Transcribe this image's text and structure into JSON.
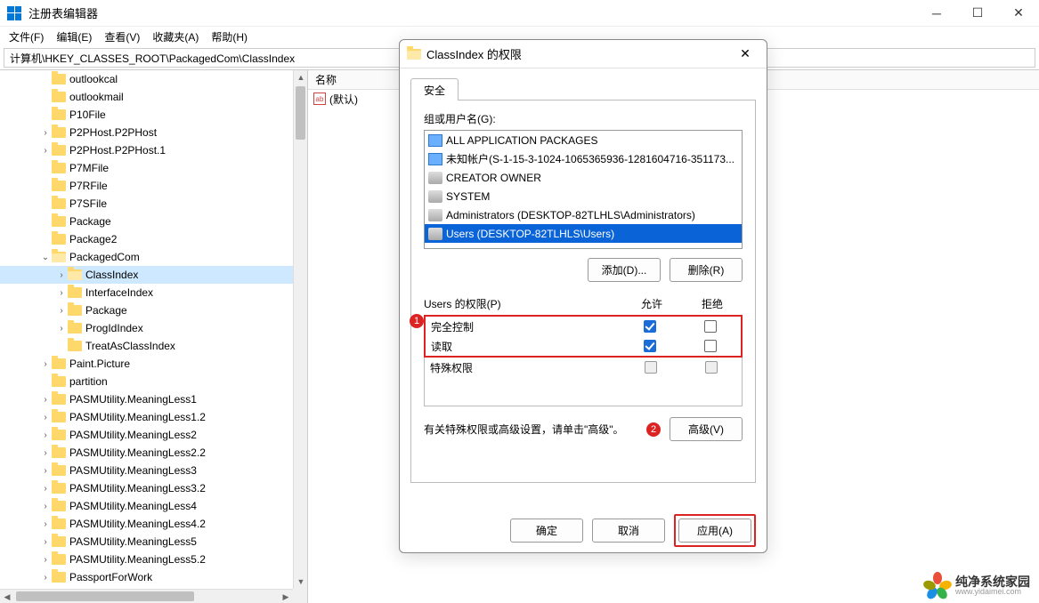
{
  "window": {
    "title": "注册表编辑器",
    "menu": [
      "文件(F)",
      "编辑(E)",
      "查看(V)",
      "收藏夹(A)",
      "帮助(H)"
    ],
    "address": "计算机\\HKEY_CLASSES_ROOT\\PackagedCom\\ClassIndex"
  },
  "tree": [
    {
      "indent": 2,
      "expander": "",
      "label": "outlookcal"
    },
    {
      "indent": 2,
      "expander": "",
      "label": "outlookmail"
    },
    {
      "indent": 2,
      "expander": "",
      "label": "P10File"
    },
    {
      "indent": 2,
      "expander": ">",
      "label": "P2PHost.P2PHost"
    },
    {
      "indent": 2,
      "expander": ">",
      "label": "P2PHost.P2PHost.1"
    },
    {
      "indent": 2,
      "expander": "",
      "label": "P7MFile"
    },
    {
      "indent": 2,
      "expander": "",
      "label": "P7RFile"
    },
    {
      "indent": 2,
      "expander": "",
      "label": "P7SFile"
    },
    {
      "indent": 2,
      "expander": "",
      "label": "Package"
    },
    {
      "indent": 2,
      "expander": "",
      "label": "Package2"
    },
    {
      "indent": 2,
      "expander": "v",
      "label": "PackagedCom",
      "open": true
    },
    {
      "indent": 3,
      "expander": ">",
      "label": "ClassIndex",
      "open": true,
      "selected": true
    },
    {
      "indent": 3,
      "expander": ">",
      "label": "InterfaceIndex"
    },
    {
      "indent": 3,
      "expander": ">",
      "label": "Package"
    },
    {
      "indent": 3,
      "expander": ">",
      "label": "ProgIdIndex"
    },
    {
      "indent": 3,
      "expander": "",
      "label": "TreatAsClassIndex"
    },
    {
      "indent": 2,
      "expander": ">",
      "label": "Paint.Picture"
    },
    {
      "indent": 2,
      "expander": "",
      "label": "partition"
    },
    {
      "indent": 2,
      "expander": ">",
      "label": "PASMUtility.MeaningLess1"
    },
    {
      "indent": 2,
      "expander": ">",
      "label": "PASMUtility.MeaningLess1.2"
    },
    {
      "indent": 2,
      "expander": ">",
      "label": "PASMUtility.MeaningLess2"
    },
    {
      "indent": 2,
      "expander": ">",
      "label": "PASMUtility.MeaningLess2.2"
    },
    {
      "indent": 2,
      "expander": ">",
      "label": "PASMUtility.MeaningLess3"
    },
    {
      "indent": 2,
      "expander": ">",
      "label": "PASMUtility.MeaningLess3.2"
    },
    {
      "indent": 2,
      "expander": ">",
      "label": "PASMUtility.MeaningLess4"
    },
    {
      "indent": 2,
      "expander": ">",
      "label": "PASMUtility.MeaningLess4.2"
    },
    {
      "indent": 2,
      "expander": ">",
      "label": "PASMUtility.MeaningLess5"
    },
    {
      "indent": 2,
      "expander": ">",
      "label": "PASMUtility.MeaningLess5.2"
    },
    {
      "indent": 2,
      "expander": ">",
      "label": "PassportForWork"
    }
  ],
  "list": {
    "header_name": "名称",
    "default_value_label": "(默认)",
    "string_icon_label": "ab"
  },
  "dialog": {
    "title": "ClassIndex 的权限",
    "tab_security": "安全",
    "group_label": "组或用户名(G):",
    "groups": [
      {
        "icon": "pkg",
        "label": "ALL APPLICATION PACKAGES"
      },
      {
        "icon": "pkg",
        "label": "未知帐户(S-1-15-3-1024-1065365936-1281604716-351173..."
      },
      {
        "icon": "grp",
        "label": "CREATOR OWNER"
      },
      {
        "icon": "grp",
        "label": "SYSTEM"
      },
      {
        "icon": "grp",
        "label": "Administrators (DESKTOP-82TLHLS\\Administrators)"
      },
      {
        "icon": "grp",
        "label": "Users (DESKTOP-82TLHLS\\Users)",
        "selected": true
      }
    ],
    "btn_add": "添加(D)...",
    "btn_remove": "删除(R)",
    "perm_label": "Users 的权限(P)",
    "col_allow": "允许",
    "col_deny": "拒绝",
    "perms": [
      {
        "name": "完全控制",
        "allow": true,
        "deny": false
      },
      {
        "name": "读取",
        "allow": true,
        "deny": false
      }
    ],
    "perm_special": "特殊权限",
    "badge1": "1",
    "badge2": "2",
    "advanced_text": "有关特殊权限或高级设置，请单击\"高级\"。",
    "btn_advanced": "高级(V)",
    "btn_ok": "确定",
    "btn_cancel": "取消",
    "btn_apply": "应用(A)"
  },
  "watermark": {
    "text": "纯净系统家园",
    "sub": "www.yidaimei.com"
  }
}
